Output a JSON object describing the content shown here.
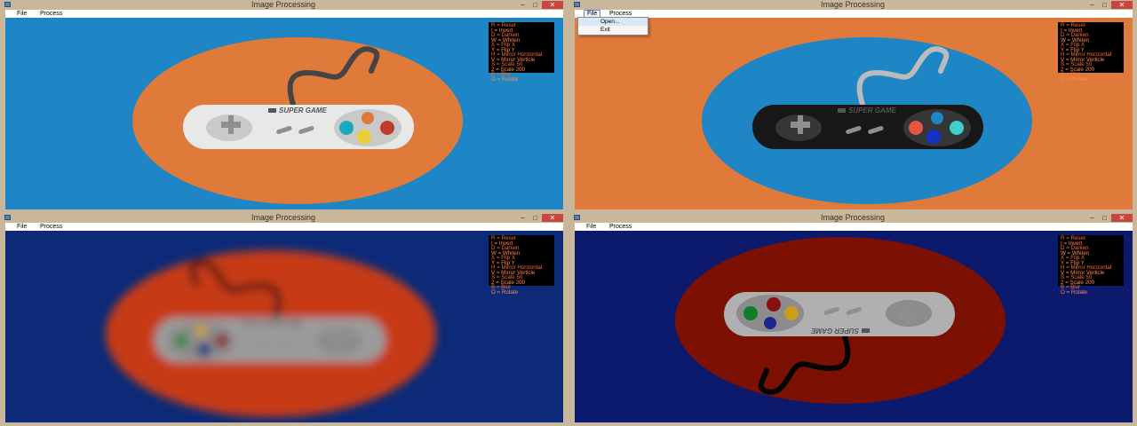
{
  "windows": [
    {
      "title": "Image Processing",
      "menu": [
        "File",
        "Process"
      ],
      "colors": {
        "background": "#1f86c6",
        "disk": "#e07a3b",
        "controller": "#e8e8e8",
        "grip": "#c9c9c9",
        "cable": "#444444",
        "buttons": [
          "#1aa7c0",
          "#e9ce36",
          "#bf3a2f",
          "#e07a3b"
        ]
      }
    },
    {
      "title": "Image Processing",
      "menu": [
        "File",
        "Process"
      ],
      "colors": {
        "background": "#e07a3b",
        "disk": "#1f86c6",
        "controller": "#171717",
        "grip": "#363636",
        "cable": "#bbbbbb",
        "buttons": [
          "#e55840",
          "#1631c9",
          "#40d0cf",
          "#1f86c6"
        ]
      }
    },
    {
      "title": "Image Processing",
      "menu": [
        "File",
        "Process"
      ],
      "colors": {
        "background": "#0c2a78",
        "disk": "#c63a12",
        "controller": "#9b9b9b",
        "grip": "#8b8b8b",
        "cable": "#111111",
        "buttons": [
          "#8a2a2a",
          "#1a3e80",
          "#2a8a4a",
          "#c9a020"
        ]
      }
    },
    {
      "title": "Image Processing",
      "menu": [
        "File",
        "Process"
      ],
      "colors": {
        "background": "#0c1a6e",
        "disk": "#7c1002",
        "controller": "#b0b0b0",
        "grip": "#8c8c8c",
        "cable": "#050505",
        "buttons": [
          "#cc9d1a",
          "#8b0f0f",
          "#0f7d2a",
          "#1a2a8a"
        ]
      }
    }
  ],
  "controller_brand": "SUPER GAME",
  "legend": [
    "R = Reset",
    "I = Invert",
    "D = Darken",
    "W = Whiten",
    "X = Flip X",
    "Y = Flip Y",
    "H = Mirror Horizontal",
    "V = Mirror Verticle",
    "S = Scale 50",
    "2 = Scale 200",
    "B = Blur",
    "O = Rotate"
  ],
  "legend_colors": [
    "#ff6a2a",
    "#ff8a4a"
  ],
  "file_menu": {
    "open": "Open...",
    "exit": "Exit"
  }
}
